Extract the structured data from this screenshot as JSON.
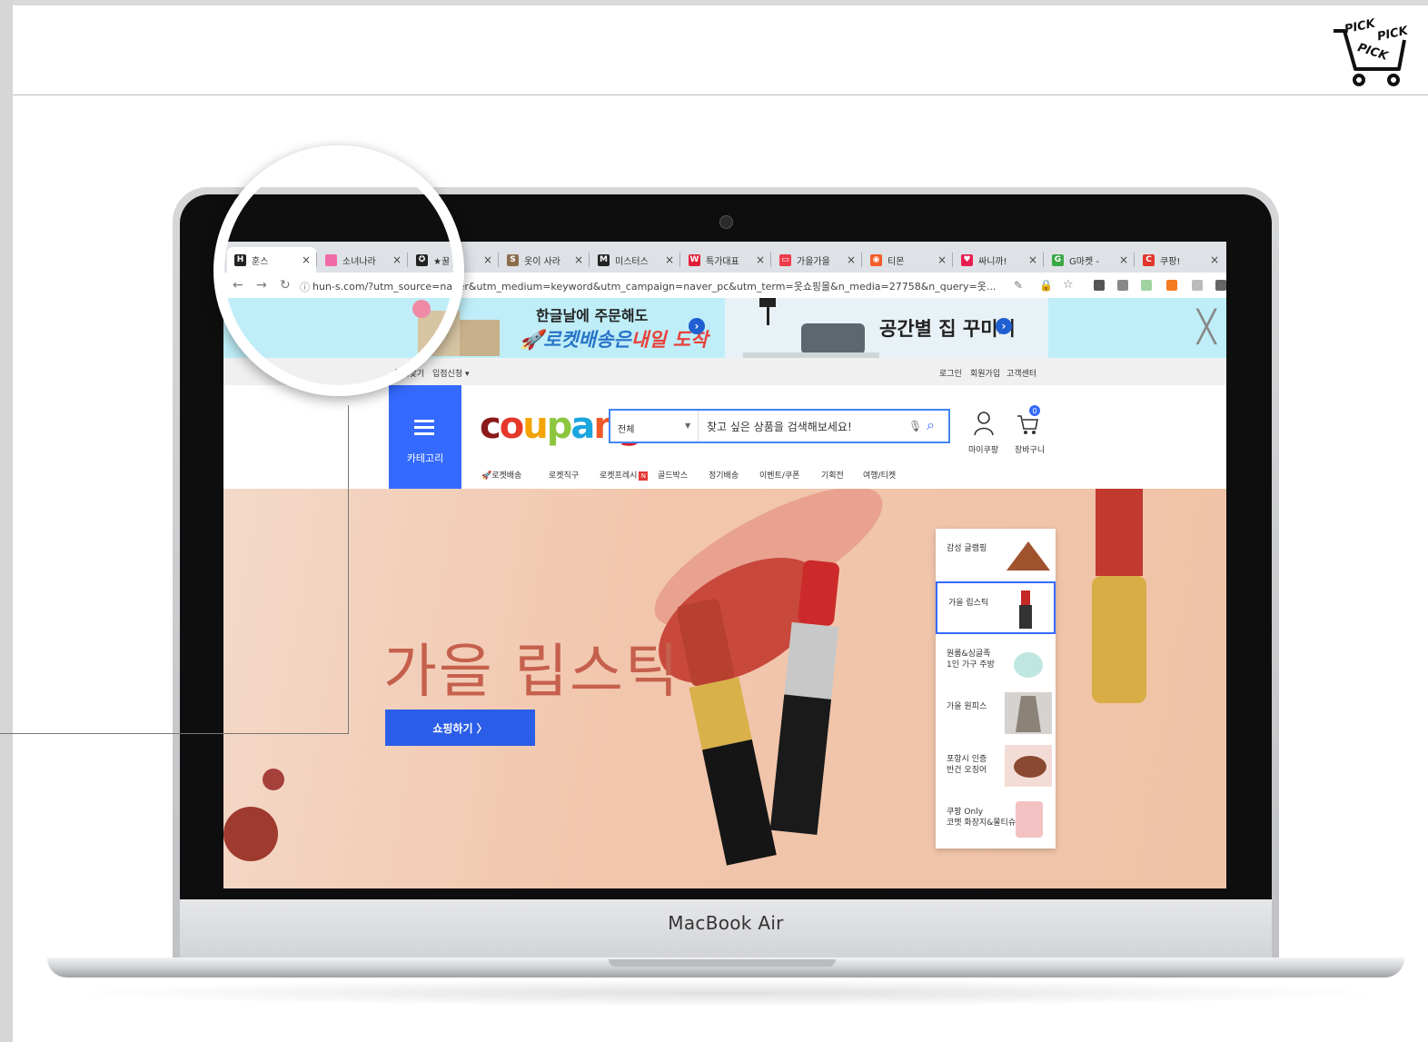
{
  "slide": {
    "logo_lines": [
      "PICK",
      "PICK",
      "PICK"
    ]
  },
  "laptop": {
    "brand": "MacBook Air"
  },
  "browser": {
    "tabs": [
      {
        "icon": "H",
        "label": "훈스",
        "color": "#222222"
      },
      {
        "icon": "",
        "label": "소녀나라",
        "color": "#f06aa8"
      },
      {
        "icon": "✪",
        "label": "★꿀",
        "color": "#222222"
      },
      {
        "icon": "S",
        "label": "옷이 사라",
        "color": "#8b6e4e"
      },
      {
        "icon": "M",
        "label": "미스터스",
        "color": "#222222"
      },
      {
        "icon": "W",
        "label": "특가대표",
        "color": "#e0203a"
      },
      {
        "icon": "▭",
        "label": "가을가을",
        "color": "#ef3b4a"
      },
      {
        "icon": "◉",
        "label": "티몬",
        "color": "#f25c2a"
      },
      {
        "icon": "♥",
        "label": "싸니까!",
        "color": "#e81d4f"
      },
      {
        "icon": "G",
        "label": "G마켓 -",
        "color": "#3aa845"
      },
      {
        "icon": "C",
        "label": "쿠팡!",
        "color": "#e2352d"
      }
    ],
    "url": "hun-s.com/?utm_source=naver&utm_medium=keyword&utm_campaign=naver_pc&utm_term=옷쇼핑몰&n_media=27758&n_query=옷..."
  },
  "promo": {
    "left_line1": "한글날에 주문해도",
    "left_line2_a": "로켓배송은",
    "left_line2_b": "내일 도착",
    "right_text": "공간별 집 꾸미기",
    "close": "╳"
  },
  "util": {
    "left_items": [
      "즐겨찾기",
      "입점신청 ▾"
    ],
    "right_items": [
      "로그인",
      "회원가입",
      "고객센터"
    ]
  },
  "header": {
    "category_label": "카테고리",
    "logo": [
      "c",
      "o",
      "u",
      "p",
      "a",
      "n",
      "g"
    ],
    "logo_colors": [
      "#8b1a1a",
      "#e5382b",
      "#f4a300",
      "#8cc63f",
      "#1ba6de",
      "#ef5a28",
      "#d31e25"
    ],
    "search_scope": "전체",
    "search_placeholder": "찾고 싶은 상품을 검색해보세요!",
    "my_label": "마이쿠팡",
    "cart_label": "장바구니",
    "cart_count": "0",
    "gnb": [
      "로켓배송",
      "로켓직구",
      "로켓프레시",
      "골드박스",
      "정기배송",
      "이벤트/쿠폰",
      "기획전",
      "여행/티켓"
    ],
    "new_badge": "N"
  },
  "hero": {
    "title": "가을 립스틱",
    "button": "쇼핑하기 〉",
    "side_items": [
      {
        "label": [
          "감성 글램핑"
        ]
      },
      {
        "label": [
          "가을 립스틱"
        ]
      },
      {
        "label": [
          "원룸&싱글족",
          "1인 가구 주방"
        ]
      },
      {
        "label": [
          "가을 원피스"
        ]
      },
      {
        "label": [
          "포항시 인증",
          "반건 오징어"
        ]
      },
      {
        "label": [
          "쿠팡 Only",
          "코멧 화장지&물티슈"
        ]
      }
    ]
  },
  "colors": {
    "coupang_blue": "#346aff",
    "hero_title": "#c5604d"
  }
}
